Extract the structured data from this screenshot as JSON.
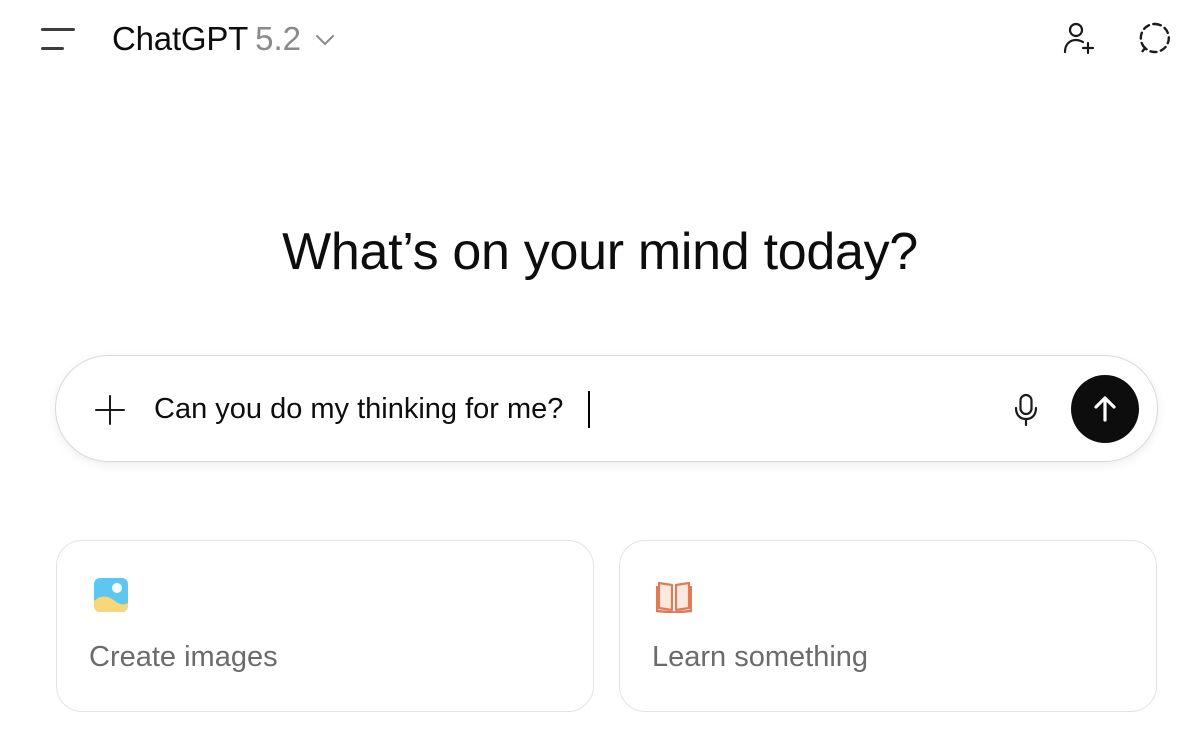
{
  "header": {
    "model_name": "ChatGPT",
    "model_version": "5.2",
    "icons": {
      "menu": "menu-icon",
      "model_dropdown": "chevron-down-icon",
      "add_user": "add-user-icon",
      "temporary_chat": "temporary-chat-icon"
    }
  },
  "main": {
    "heading": "What’s on your mind today?"
  },
  "composer": {
    "value": "Can you do my thinking for me?",
    "icons": {
      "attach": "plus-icon",
      "voice": "microphone-icon",
      "send": "arrow-up-icon"
    }
  },
  "suggestions": [
    {
      "label": "Create images",
      "icon": "image-icon"
    },
    {
      "label": "Learn something",
      "icon": "book-icon"
    }
  ],
  "colors": {
    "text": "#0d0d0d",
    "muted": "#8a8a8a",
    "card_text": "#6b6b6b",
    "send_button": "#0d0d0d",
    "image_icon_sky": "#5cc8f2",
    "image_icon_sand": "#f7d77a",
    "book_icon": "#e07a57"
  }
}
